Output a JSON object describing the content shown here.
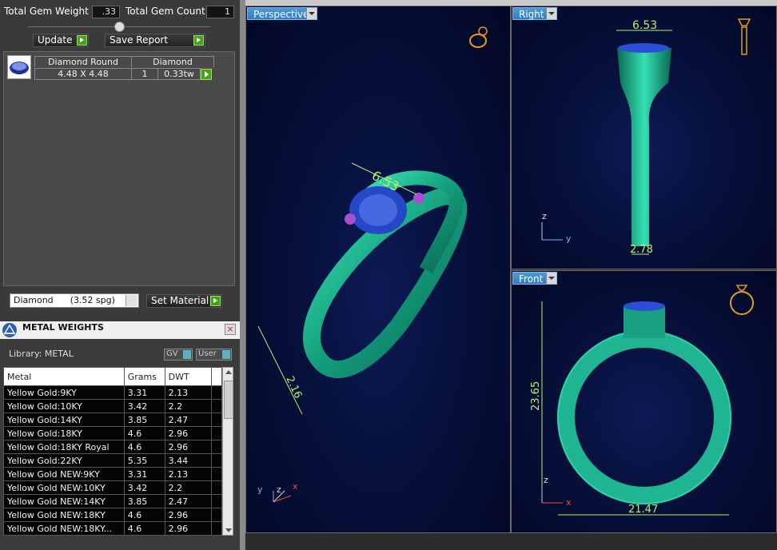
{
  "gems": {
    "total_weight_label": "Total Gem Weight",
    "total_weight_value": ".33",
    "total_count_label": "Total Gem Count",
    "total_count_value": "1",
    "update_label": "Update",
    "save_report_label": "Save Report",
    "header_shape": "Diamond Round",
    "header_material": "Diamond",
    "row_size": "4.48 X 4.48",
    "row_qty": "1",
    "row_weight": "0.33tw"
  },
  "material": {
    "select_value": "Diamond      (3.52 spg)",
    "set_material_label": "Set Material"
  },
  "metal_weights": {
    "title": "METAL WEIGHTS",
    "library_label": "Library: METAL",
    "gv_label": "GV",
    "user_label": "User",
    "columns": [
      "Metal",
      "Grams",
      "DWT"
    ],
    "rows": [
      [
        "Yellow Gold:9KY",
        "3.31",
        "2.13"
      ],
      [
        "Yellow Gold:10KY",
        "3.42",
        "2.2"
      ],
      [
        "Yellow Gold:14KY",
        "3.85",
        "2.47"
      ],
      [
        "Yellow Gold:18KY",
        "4.6",
        "2.96"
      ],
      [
        "Yellow Gold:18KY Royal",
        "4.6",
        "2.96"
      ],
      [
        "Yellow Gold:22KY",
        "5.35",
        "3.44"
      ],
      [
        "Yellow Gold NEW:9KY",
        "3.31",
        "2.13"
      ],
      [
        "Yellow Gold NEW:10KY",
        "3.42",
        "2.2"
      ],
      [
        "Yellow Gold NEW:14KY",
        "3.85",
        "2.47"
      ],
      [
        "Yellow Gold NEW:18KY",
        "4.6",
        "2.96"
      ],
      [
        "Yellow Gold NEW:18KY...",
        "4.6",
        "2.96"
      ]
    ]
  },
  "views": {
    "perspective": {
      "label": "Perspective",
      "dim_top": "6.53",
      "dim_side": "2.16"
    },
    "right": {
      "label": "Right",
      "dim_top": "6.53",
      "dim_bottom": "2.78"
    },
    "front": {
      "label": "Front",
      "dim_height": "23.65",
      "dim_width": "21.47"
    },
    "axis": {
      "x": "x",
      "y": "y",
      "z": "z"
    }
  },
  "colors": {
    "ring": "#1fb592",
    "dimension": "#b8f06a",
    "gem": "#2a4fd6",
    "accent_green": "#47a21a"
  }
}
